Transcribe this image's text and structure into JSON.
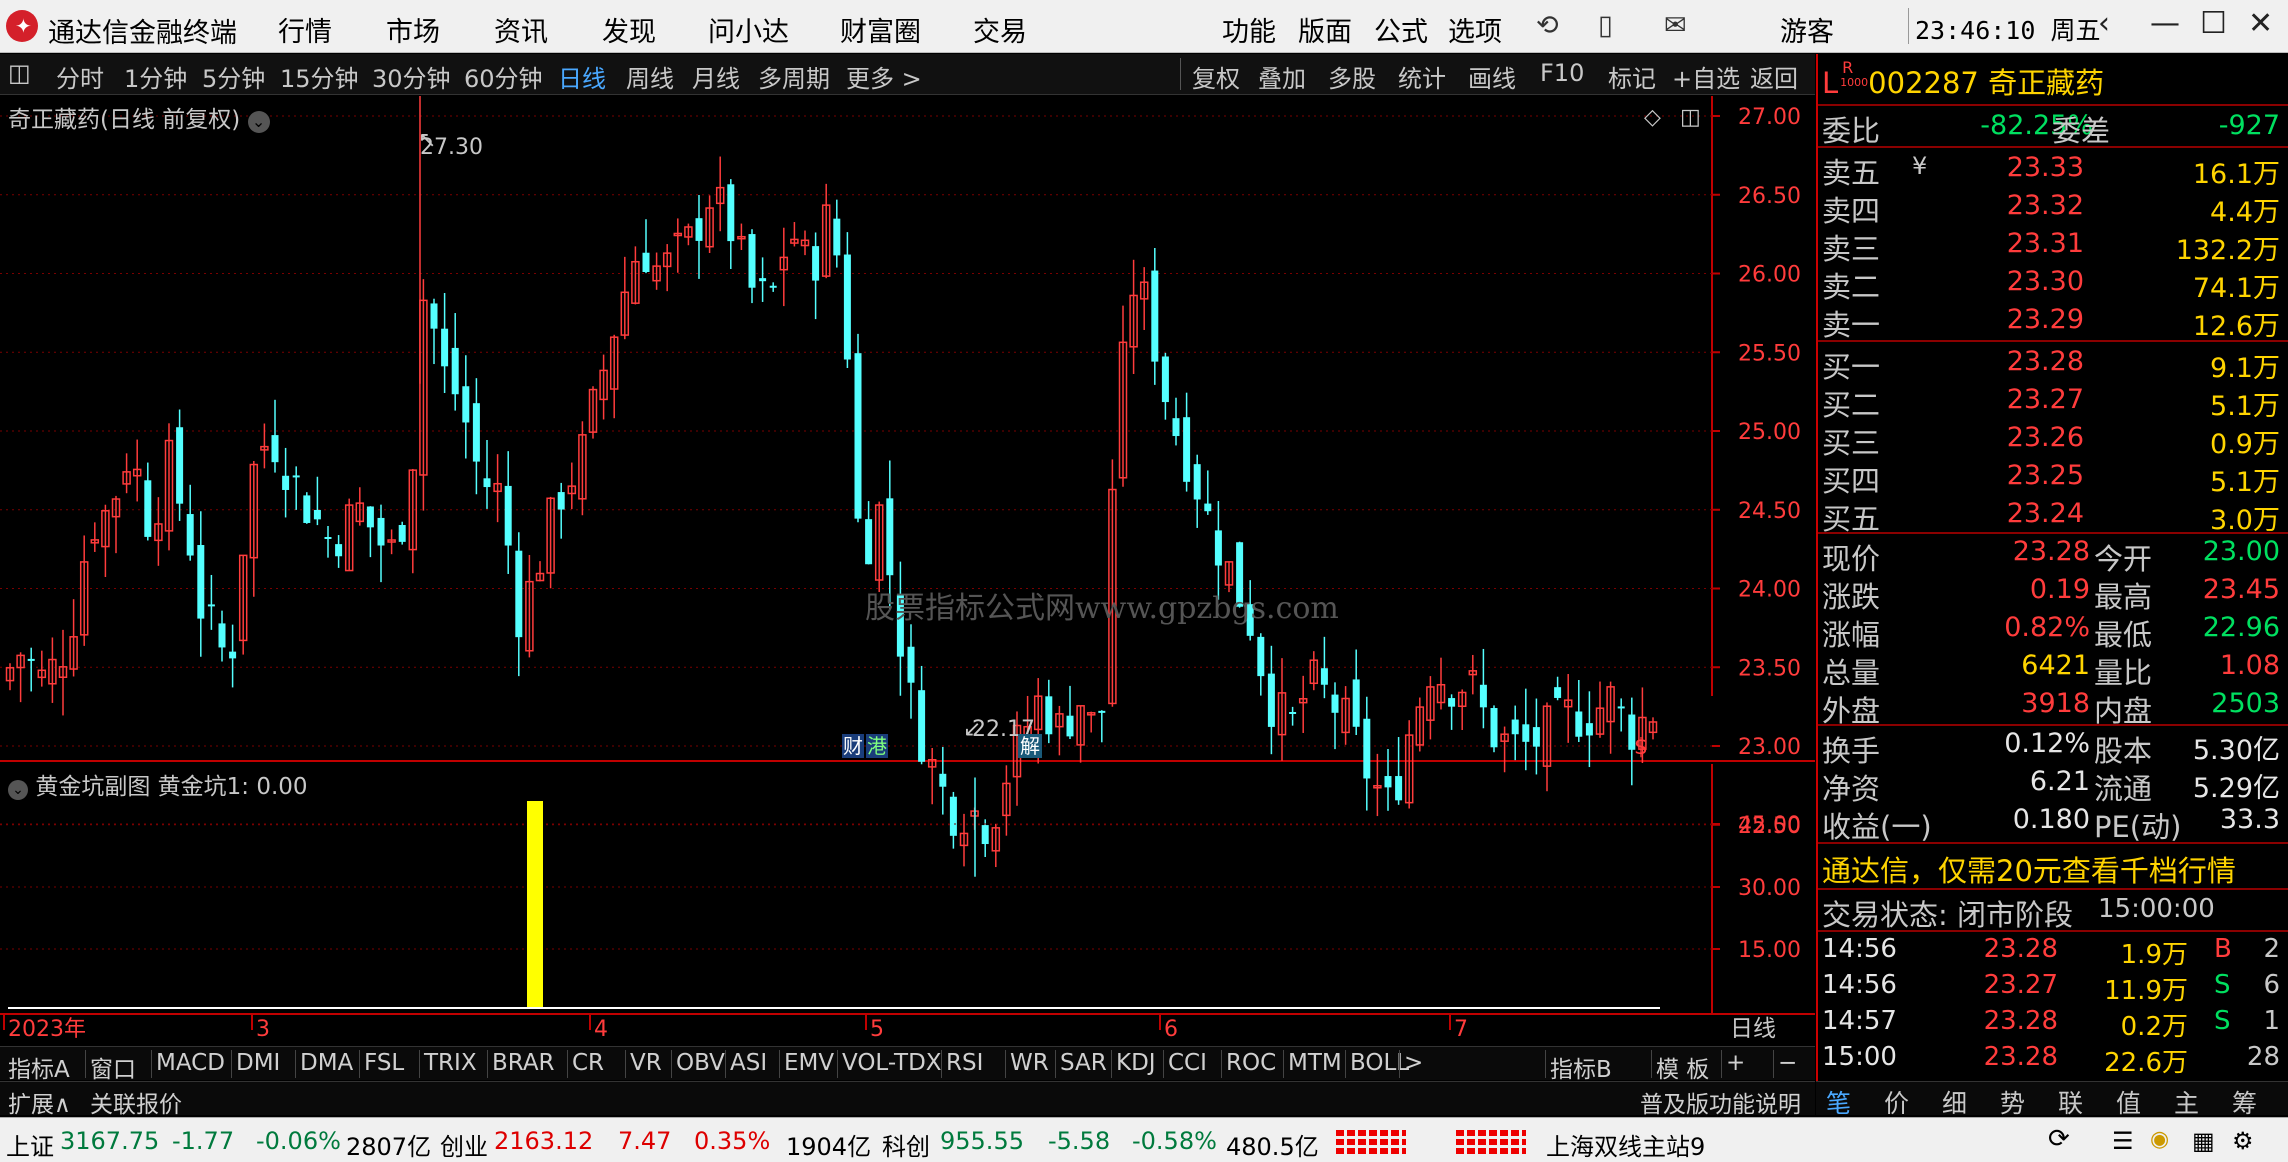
{
  "titlebar": {
    "logo_glyph": "✦",
    "app_name": "通达信金融终端",
    "menus": [
      "行情",
      "市场",
      "资讯",
      "发现",
      "问小达",
      "财富圈",
      "交易"
    ],
    "right_menus": [
      "功能",
      "版面",
      "公式",
      "选项"
    ],
    "user": "游客",
    "clock": "23:46:10 周五",
    "icons": [
      "refresh-icon",
      "phone-icon",
      "mail-icon",
      "back-icon",
      "minimize-icon",
      "maximize-icon",
      "close-icon"
    ]
  },
  "toolbar": {
    "periods": [
      "分时",
      "1分钟",
      "5分钟",
      "15分钟",
      "30分钟",
      "60分钟",
      "日线",
      "周线",
      "月线",
      "多周期",
      "更多 >"
    ],
    "active": "日线",
    "actions": [
      "复权",
      "叠加",
      "多股",
      "统计",
      "画线",
      "F10",
      "标记",
      "+自选",
      "返回"
    ]
  },
  "main_chart": {
    "title": "奇正藏药(日线 前复权)",
    "high_label": "27.30",
    "low_label": "22.17",
    "watermark": "股票指标公式网www.gpzbgs.com",
    "markers": [
      "财",
      "港",
      "解",
      "$"
    ],
    "price_axis": [
      "27.00",
      "26.50",
      "26.00",
      "25.50",
      "25.00",
      "24.50",
      "24.00",
      "23.50",
      "23.00",
      "22.50"
    ]
  },
  "sub_chart": {
    "title": "黄金坑副图  黄金坑1: 0.00",
    "axis": [
      "45.00",
      "30.00",
      "15.00"
    ],
    "date_labels": [
      "2023年",
      "3",
      "4",
      "5",
      "6",
      "7"
    ],
    "period_label": "日线"
  },
  "indicators": [
    "指标A",
    "窗口",
    "MACD",
    "DMI",
    "DMA",
    "FSL",
    "TRIX",
    "BRAR",
    "CR",
    "VR",
    "OBV",
    "ASI",
    "EMV",
    "VOL-TDX",
    "RSI",
    "WR",
    "SAR",
    "KDJ",
    "CCI",
    "ROC",
    "MTM",
    "BOLL",
    ">",
    "指标B",
    "模 板",
    "+",
    "−"
  ],
  "extbar": {
    "left": [
      "扩展∧",
      "关联报价"
    ],
    "right": "普及版功能说明"
  },
  "quote": {
    "prefix": "L",
    "prefix_sup": "R",
    "prefix_sub": "1000",
    "code": "002287",
    "name": "奇正藏药",
    "weibi_label": "委比",
    "weibi": "-82.25%",
    "weicha_label": "委差",
    "weicha": "-927",
    "asks": [
      {
        "label": "卖五",
        "price": "23.33",
        "vol": "16.1万"
      },
      {
        "label": "卖四",
        "price": "23.32",
        "vol": "4.4万"
      },
      {
        "label": "卖三",
        "price": "23.31",
        "vol": "132.2万"
      },
      {
        "label": "卖二",
        "price": "23.30",
        "vol": "74.1万"
      },
      {
        "label": "卖一",
        "price": "23.29",
        "vol": "12.6万"
      }
    ],
    "bids": [
      {
        "label": "买一",
        "price": "23.28",
        "vol": "9.1万"
      },
      {
        "label": "买二",
        "price": "23.27",
        "vol": "5.1万"
      },
      {
        "label": "买三",
        "price": "23.26",
        "vol": "0.9万"
      },
      {
        "label": "买四",
        "price": "23.25",
        "vol": "5.1万"
      },
      {
        "label": "买五",
        "price": "23.24",
        "vol": "3.0万"
      }
    ],
    "stats": [
      {
        "l1": "现价",
        "v1": "23.28",
        "c1": "red",
        "l2": "今开",
        "v2": "23.00",
        "c2": "green"
      },
      {
        "l1": "涨跌",
        "v1": "0.19",
        "c1": "red",
        "l2": "最高",
        "v2": "23.45",
        "c2": "red"
      },
      {
        "l1": "涨幅",
        "v1": "0.82%",
        "c1": "red",
        "l2": "最低",
        "v2": "22.96",
        "c2": "green"
      },
      {
        "l1": "总量",
        "v1": "6421",
        "c1": "yellow",
        "l2": "量比",
        "v2": "1.08",
        "c2": "red"
      },
      {
        "l1": "外盘",
        "v1": "3918",
        "c1": "red",
        "l2": "内盘",
        "v2": "2503",
        "c2": "green"
      }
    ],
    "stats2": [
      {
        "l1": "换手",
        "v1": "0.12%",
        "l2": "股本",
        "v2": "5.30亿"
      },
      {
        "l1": "净资",
        "v1": "6.21",
        "l2": "流通",
        "v2": "5.29亿"
      },
      {
        "l1": "收益(一)",
        "v1": "0.180",
        "l2": "PE(动)",
        "v2": "33.3"
      }
    ],
    "ad": "通达信，仅需20元查看千档行情",
    "trade_status_label": "交易状态: 闭市阶段",
    "trade_status_time": "15:00:00",
    "ticks": [
      {
        "time": "14:56",
        "price": "23.28",
        "vol": "1.9万",
        "side": "B",
        "n": "2"
      },
      {
        "time": "14:56",
        "price": "23.27",
        "vol": "11.9万",
        "side": "S",
        "n": "6"
      },
      {
        "time": "14:57",
        "price": "23.28",
        "vol": "0.2万",
        "side": "S",
        "n": "1"
      },
      {
        "time": "15:00",
        "price": "23.28",
        "vol": "22.6万",
        "side": "",
        "n": "28"
      }
    ]
  },
  "right_tabs": [
    "笔",
    "价",
    "细",
    "势",
    "联",
    "值",
    "主",
    "筹"
  ],
  "statusbar": {
    "sh_label": "上证",
    "sh_val": "3167.75",
    "sh_chg": "-1.77",
    "sh_pct": "-0.06%",
    "sh_amt": "2807亿",
    "cy_label": "创业",
    "cy_val": "2163.12",
    "cy_chg": "7.47",
    "cy_pct": "0.35%",
    "cy_amt": "1904亿",
    "kc_label": "科创",
    "kc_val": "955.55",
    "kc_chg": "-5.58",
    "kc_pct": "-0.58%",
    "kc_amt": "480.5亿",
    "server": "上海双线主站9"
  },
  "colors": {
    "up": "#ff3c3c",
    "down": "#54ffff",
    "axis": "#c00000",
    "bar": "#ffff00"
  }
}
